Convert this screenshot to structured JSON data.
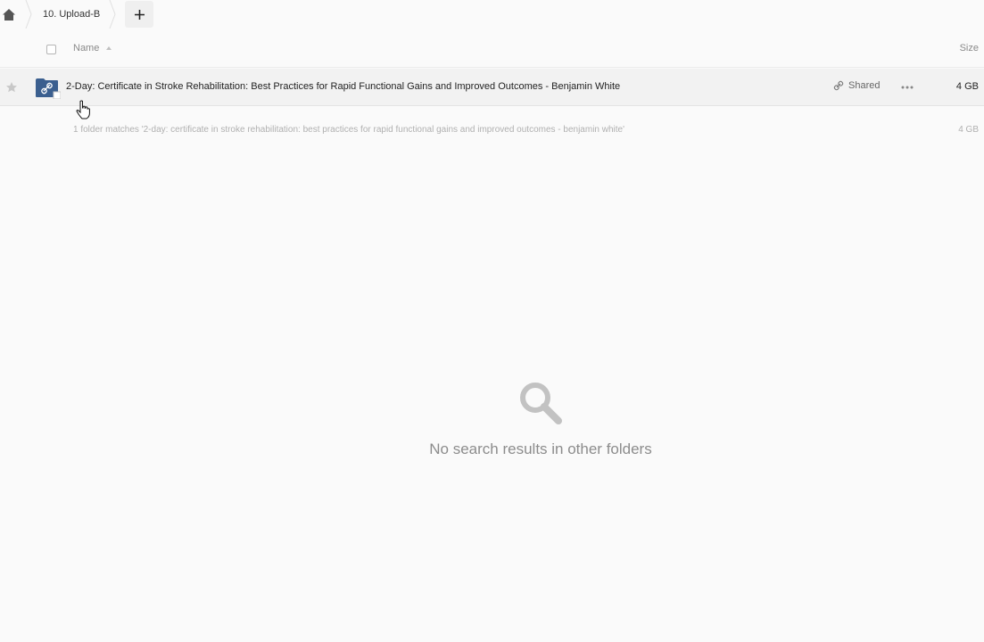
{
  "breadcrumb": {
    "home_icon": "home-icon",
    "current": "10. Upload-B",
    "add_icon": "plus-icon"
  },
  "header": {
    "name_label": "Name",
    "size_label": "Size",
    "sort_direction": "ascending"
  },
  "rows": [
    {
      "name": "2-Day: Certificate in Stroke Rehabilitation: Best Practices for Rapid Functional Gains and Improved Outcomes - Benjamin White",
      "type_icon": "shared-link-folder-icon",
      "shared_label": "Shared",
      "size": "4 GB",
      "starred": false
    }
  ],
  "summary": {
    "text": "1 folder matches '2-day: certificate in stroke rehabilitation: best practices for rapid functional gains and improved outcomes - benjamin white'",
    "size": "4 GB"
  },
  "empty_state": {
    "icon": "search-icon",
    "message": "No search results in other folders"
  },
  "colors": {
    "background": "#fafafa",
    "folder": "#3b5f8f",
    "muted_text": "#8c8c8c"
  }
}
